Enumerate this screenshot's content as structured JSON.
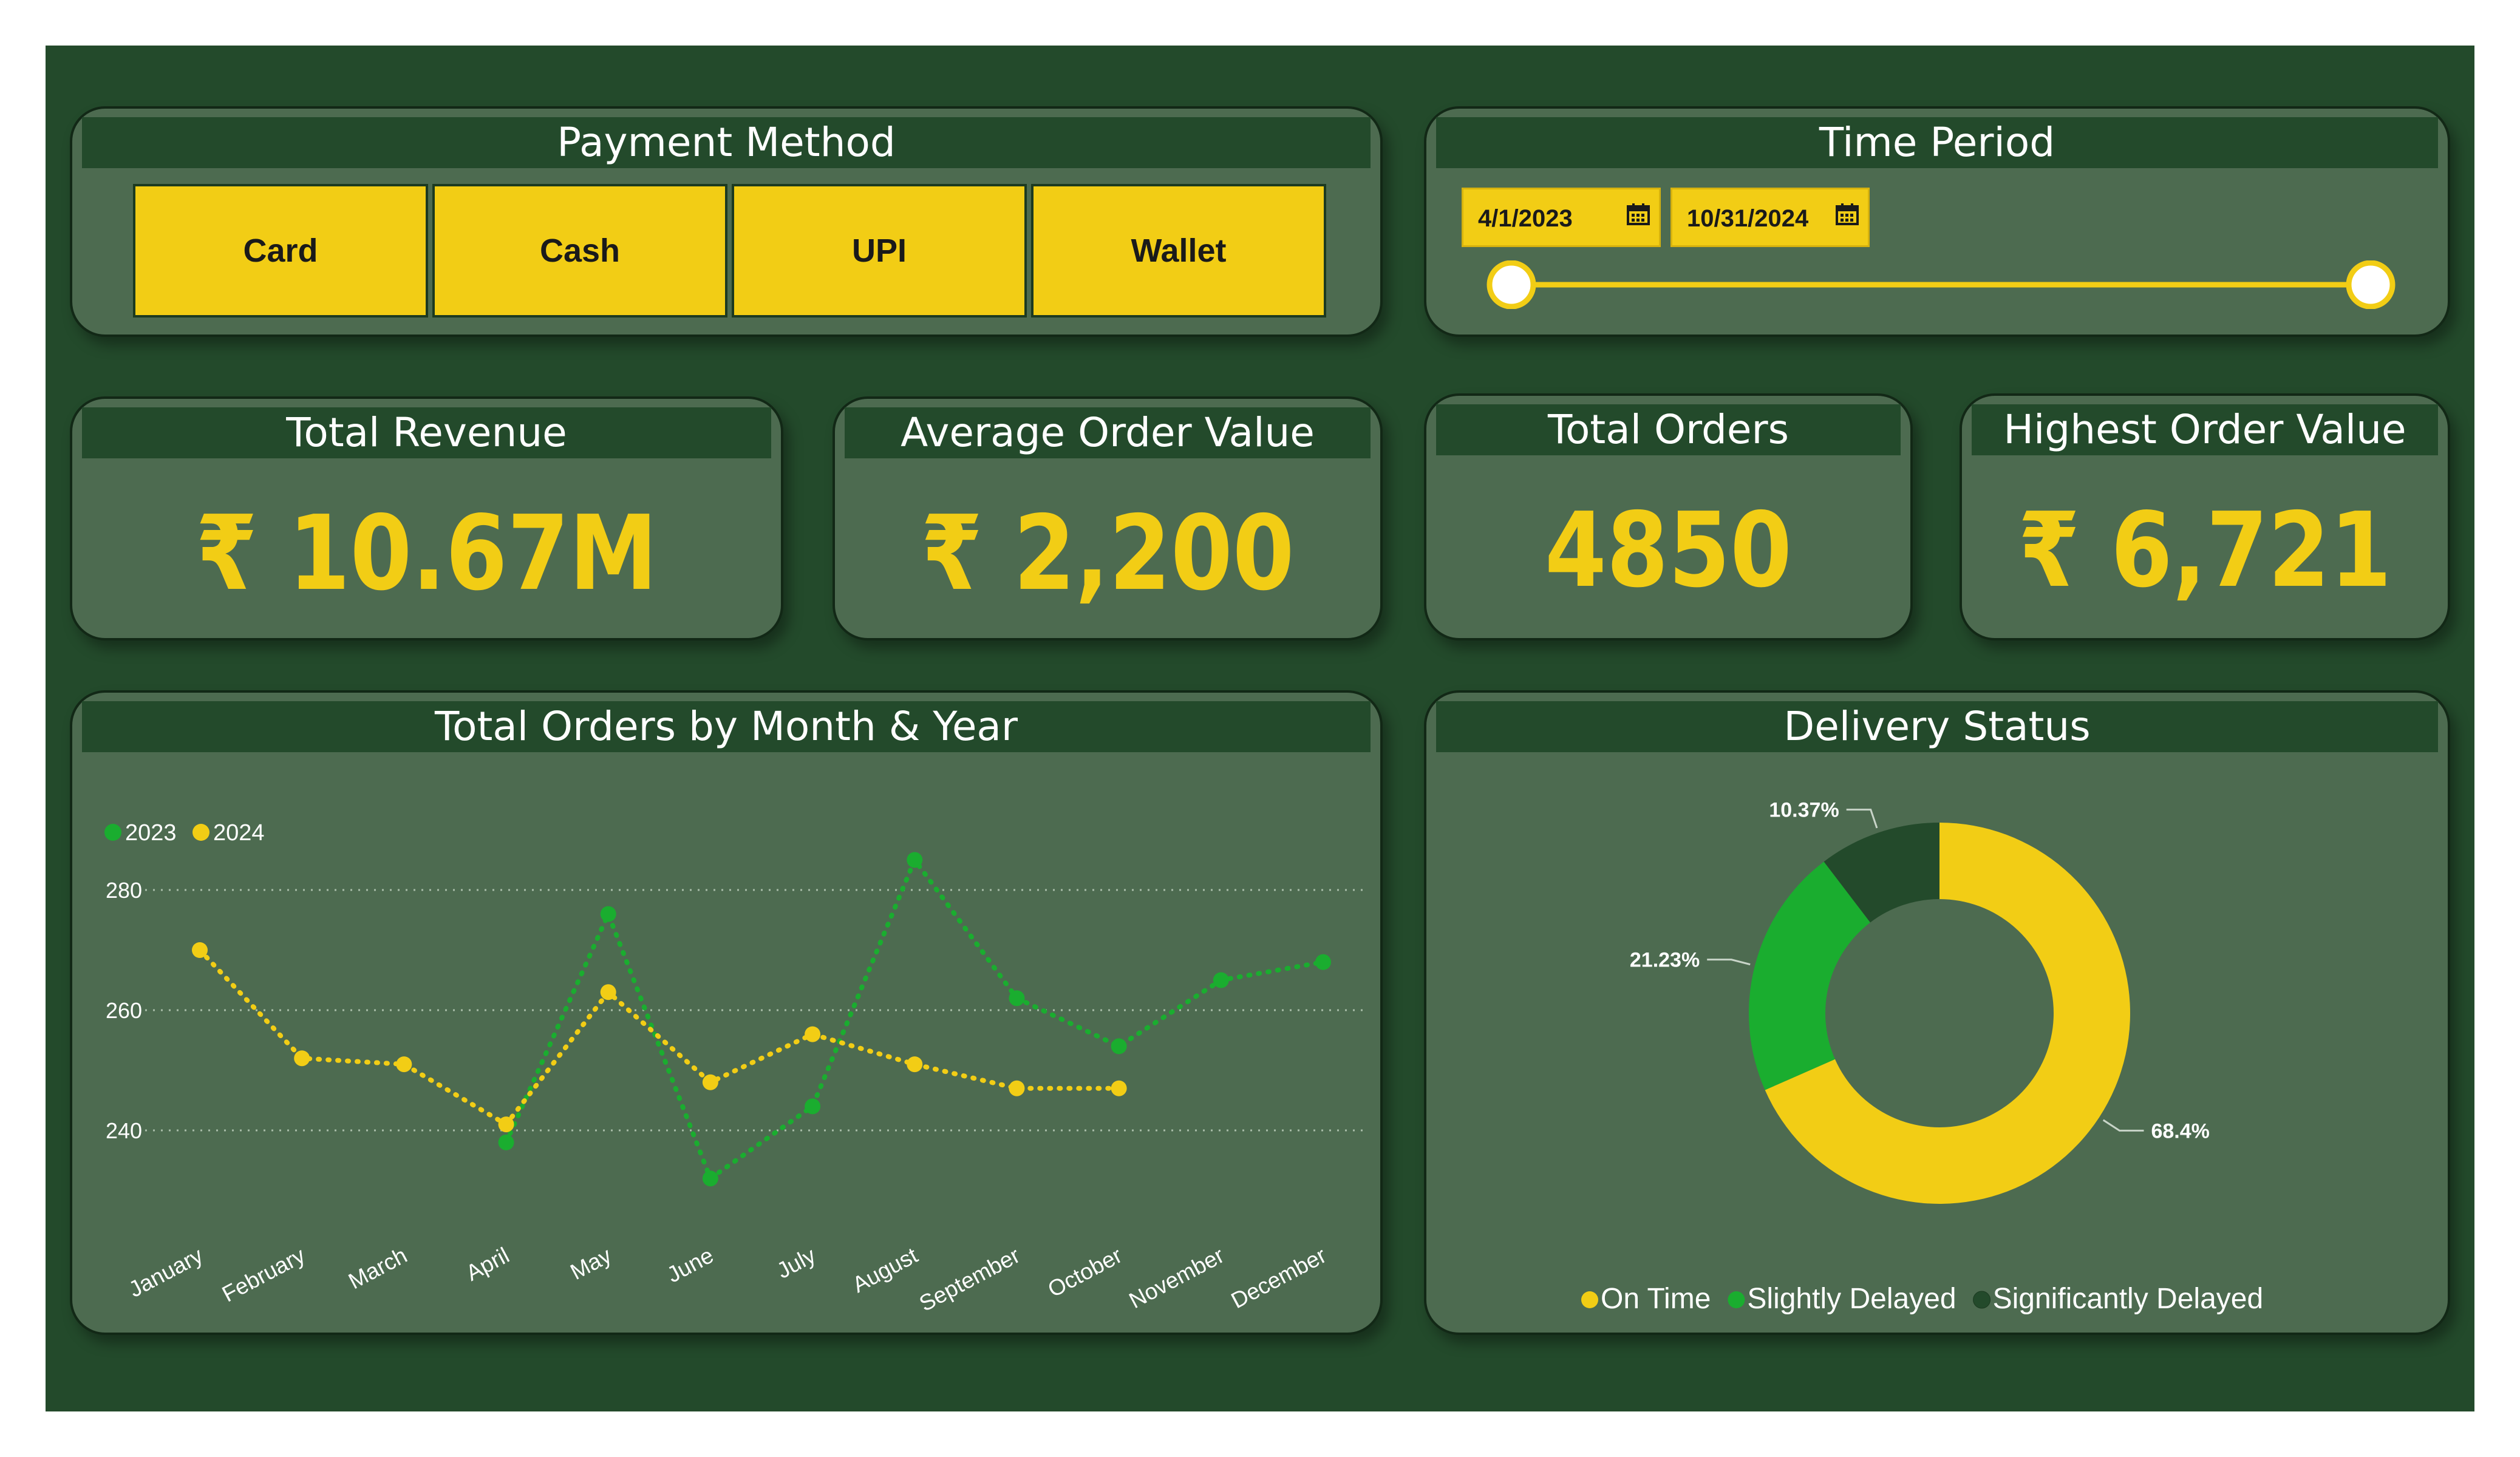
{
  "payment_method": {
    "title": "Payment Method",
    "options": [
      "Card",
      "Cash",
      "UPI",
      "Wallet"
    ]
  },
  "time_period": {
    "title": "Time Period",
    "start_date": "4/1/2023",
    "end_date": "10/31/2024",
    "range_fraction": [
      0.0,
      1.0
    ]
  },
  "kpis": {
    "total_revenue": {
      "title": "Total Revenue",
      "value": "₹ 10.67M"
    },
    "average_order_value": {
      "title": "Average Order Value",
      "value": "₹ 2,200"
    },
    "total_orders": {
      "title": "Total Orders",
      "value": "4850"
    },
    "highest_order_value": {
      "title": "Highest Order Value",
      "value": "₹ 6,721"
    }
  },
  "line_chart": {
    "title": "Total Orders by Month & Year"
  },
  "donut_chart": {
    "title": "Delivery Status"
  },
  "colors": {
    "background": "#234a2b",
    "card": "#4d6b50",
    "accent_yellow": "#f2cd15",
    "accent_green": "#1aad2f",
    "dark_green": "#234a2b"
  },
  "chart_data": [
    {
      "type": "line",
      "title": "Total Orders by Month & Year",
      "categories": [
        "January",
        "February",
        "March",
        "April",
        "May",
        "June",
        "July",
        "August",
        "September",
        "October",
        "November",
        "December"
      ],
      "series": [
        {
          "name": "2023",
          "color": "#1aad2f",
          "values": [
            null,
            null,
            null,
            238,
            276,
            232,
            244,
            285,
            262,
            254,
            265,
            268
          ]
        },
        {
          "name": "2024",
          "color": "#f2cd15",
          "values": [
            270,
            252,
            251,
            241,
            263,
            248,
            256,
            251,
            247,
            247,
            null,
            null
          ]
        }
      ],
      "yticks": [
        240,
        260,
        280
      ],
      "ylim": [
        225,
        292
      ],
      "grid": true,
      "legend": "top-left",
      "line_style": "dotted"
    },
    {
      "type": "pie",
      "style": "donut",
      "title": "Delivery Status",
      "labels": [
        "On Time",
        "Slightly Delayed",
        "Significantly Delayed"
      ],
      "values": [
        68.4,
        21.23,
        10.37
      ],
      "value_labels": [
        "68.4%",
        "21.23%",
        "10.37%"
      ],
      "colors": [
        "#f2cd15",
        "#1aad2f",
        "#234a2b"
      ],
      "legend": "bottom"
    }
  ]
}
